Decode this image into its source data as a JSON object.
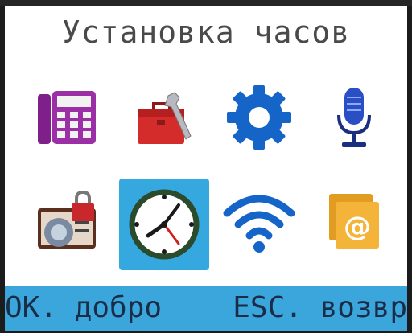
{
  "screen": {
    "title": "Установка часов"
  },
  "menu": {
    "items": [
      {
        "icon": "phone-icon"
      },
      {
        "icon": "toolbox-icon"
      },
      {
        "icon": "gear-icon"
      },
      {
        "icon": "microphone-icon"
      },
      {
        "icon": "contact-card-icon"
      },
      {
        "icon": "clock-icon",
        "selected": true
      },
      {
        "icon": "wifi-icon"
      },
      {
        "icon": "email-folder-icon"
      }
    ]
  },
  "softkeys": {
    "left": "OK. добро",
    "right": "ESC. возвр"
  },
  "colors": {
    "selection": "#35a8e0",
    "softbar": "#3aa6dc",
    "title_text": "#4a4a4a"
  }
}
